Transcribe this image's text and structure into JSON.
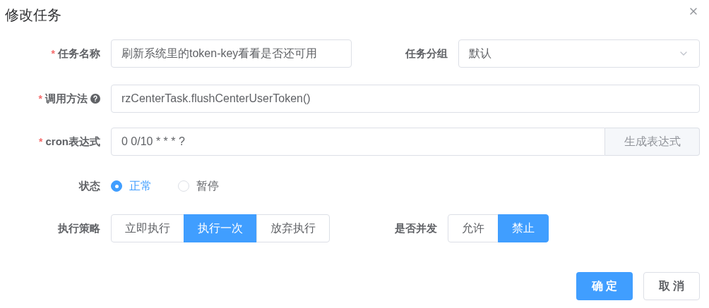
{
  "dialog": {
    "title": "修改任务"
  },
  "row_1": [
    {
      "kind": "text",
      "required_mark": "*",
      "label": "任务名称",
      "value": "刷新系统里的token-key看看是否还可用"
    },
    {
      "kind": "select",
      "label": "任务分组",
      "value": "默认"
    }
  ],
  "invoke_method": {
    "required_mark": "*",
    "label": "调用方法",
    "help": true,
    "value": "rzCenterTask.flushCenterUserToken()"
  },
  "cron": {
    "required_mark": "*",
    "label": "cron表达式",
    "value": "0 0/10 * * * ?",
    "button": "生成表达式"
  },
  "status": {
    "label": "状态",
    "options": [
      {
        "label": "正常",
        "selected": true
      },
      {
        "label": "暂停",
        "selected": false
      }
    ]
  },
  "policy": {
    "label": "执行策略",
    "options": [
      {
        "label": "立即执行",
        "selected": false
      },
      {
        "label": "执行一次",
        "selected": true
      },
      {
        "label": "放弃执行",
        "selected": false
      }
    ]
  },
  "concurrent": {
    "label": "是否并发",
    "options": [
      {
        "label": "允许",
        "selected": false
      },
      {
        "label": "禁止",
        "selected": true
      }
    ]
  },
  "footer": [
    {
      "kind": "primary",
      "label": "确 定"
    },
    {
      "kind": "default",
      "label": "取 消"
    }
  ]
}
